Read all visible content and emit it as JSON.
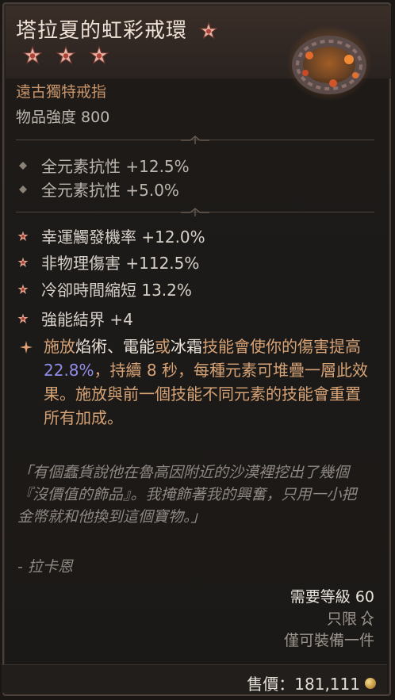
{
  "item": {
    "name": "塔拉夏的虹彩戒環",
    "type": "遠古獨特戒指",
    "power": "物品強度 800"
  },
  "implicit_stats": [
    "全元素抗性 +12.5%",
    "全元素抗性 +5.0%"
  ],
  "affixes": [
    "幸運觸發機率 +12.0%",
    "非物理傷害 +112.5%",
    "冷卻時間縮短 13.2%",
    "強能結界 +4"
  ],
  "aspect": {
    "part1": "施放",
    "kw1": "焰術",
    "sep1": "、",
    "kw2": "電能",
    "part2": "或",
    "kw3": "冰霜",
    "part3": "技能會使你的傷害提高 ",
    "value": "22.8%",
    "part4": "，持續 8 秒，每種元素可堆疊一層此效果。施放與前一個技能不同元素的技能會重置所有加成。"
  },
  "flavor": {
    "text": "「有個蠢貨說他在魯高因附近的沙漠裡挖出了幾個『沒價值的飾品』。我掩飾著我的興奮，只用一小把金幣就和他換到這個寶物。」",
    "author": "- 拉卡恩"
  },
  "requirements": {
    "level": "需要等級 60",
    "class_only": "只限",
    "unique_equipped": "僅可裝備一件"
  },
  "sell": {
    "label": "售價：181,111"
  },
  "icons": {
    "title_star": "mythic-star-icon",
    "rating_star": "rating-star-icon",
    "implicit_bullet": "diamond-bullet-icon",
    "affix_bullet": "star-bullet-icon",
    "aspect_bullet": "sparkle-bullet-icon",
    "class": "sorcerer-class-icon",
    "gold": "gold-coin-icon",
    "ring": "ring-item-icon"
  },
  "colors": {
    "title": "#f0e2d6",
    "item_type": "#c8956a",
    "aspect_text": "#d6a377",
    "aspect_value": "#8f8de8",
    "flavor": "#8f8781"
  }
}
